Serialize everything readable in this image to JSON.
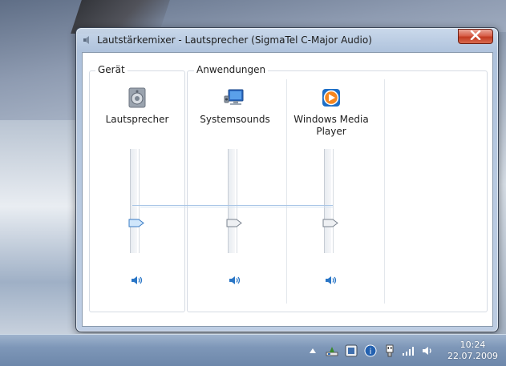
{
  "window": {
    "title": "Lautstärkemixer - Lautsprecher (SigmaTel C-Major Audio)",
    "close_icon": "close-x-icon"
  },
  "device_group": {
    "label": "Gerät",
    "items": [
      {
        "name": "Lautsprecher",
        "icon": "speaker-device-icon",
        "volume": 0.27,
        "mute_icon": "speaker-volume-icon"
      }
    ]
  },
  "apps_group": {
    "label": "Anwendungen",
    "items": [
      {
        "name": "Systemsounds",
        "icon": "system-sounds-icon",
        "volume": 0.27,
        "mute_icon": "speaker-volume-icon"
      },
      {
        "name": "Windows Media\nPlayer",
        "icon": "windows-media-player-icon",
        "volume": 0.27,
        "mute_icon": "speaker-volume-icon"
      }
    ]
  },
  "taskbar": {
    "tray_icons": [
      "show-hidden-icons-chevron",
      "usb-remove-icon",
      "action-center-icon",
      "info-icon",
      "network-plug-icon",
      "signal-bars-icon",
      "volume-icon"
    ],
    "clock": {
      "time": "10:24",
      "date": "22.07.2009"
    }
  },
  "colors": {
    "accent": "#2a76c6",
    "close_red": "#c9442b"
  }
}
